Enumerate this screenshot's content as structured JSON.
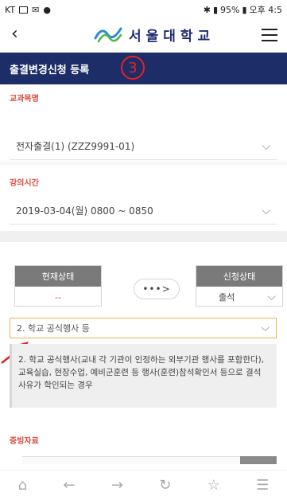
{
  "status_bar": {
    "carrier": "KT",
    "right_text": "95%",
    "time": "오후 4:5"
  },
  "header": {
    "back_icon": "chevron-left",
    "logo_text": "서울대학교",
    "menu_icon": "hamburger"
  },
  "title_bar": {
    "title": "출결변경신청 등록",
    "badge": "3",
    "badge_color": "#e52222",
    "background_color": "#1c2d68"
  },
  "course": {
    "label": "교과목명",
    "value": "전자출결(1) (ZZZ9991-01)"
  },
  "lecture_time": {
    "label": "강의시간",
    "value": "2019-03-04(월) 0800 ~ 0850"
  },
  "current_status": {
    "header": "현재상태",
    "value": "--"
  },
  "arrow": "•••>",
  "requested_status": {
    "header": "신청상태",
    "value": "출석"
  },
  "reason": {
    "value": "2. 학교 공식행사 등",
    "border_color": "#e8b64c"
  },
  "notice": {
    "text": "2. 학교 공식행사(교내 각 기관이 인정하는 외부기관 행사를 포함한다), 교육실습, 현장수업, 예비군훈련 등 행사(훈련)참석확인서 등으로 결석사유가 학인되는 경우"
  },
  "evidence": {
    "label": "증빙자료"
  },
  "bottom_nav": {
    "icons": [
      "home-icon",
      "back-arrow-icon",
      "forward-arrow-icon",
      "refresh-icon",
      "star-icon",
      "menu-icon"
    ]
  }
}
